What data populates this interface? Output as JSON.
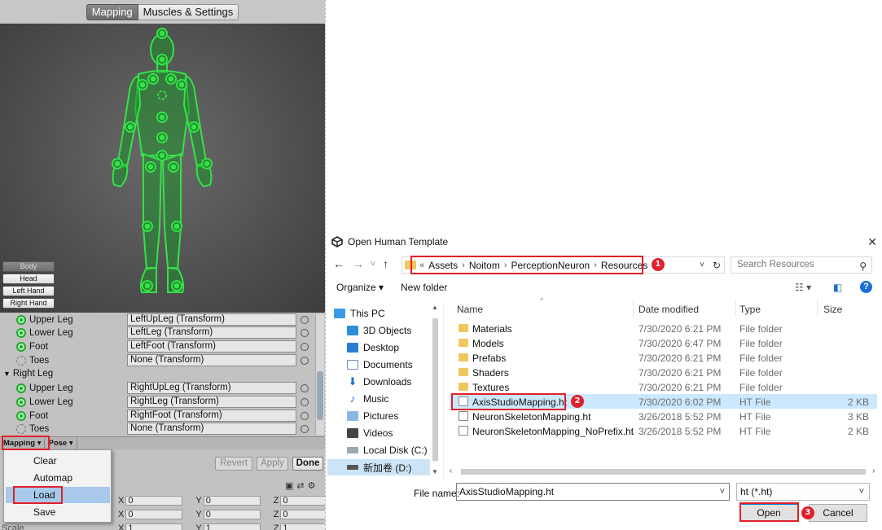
{
  "unity": {
    "tabs": [
      "Mapping",
      "Muscles & Settings"
    ],
    "group_buttons": [
      "Body",
      "Head",
      "Left Hand",
      "Right Hand"
    ],
    "rows": [
      {
        "label": "Upper Leg",
        "value": "LeftUpLeg (Transform)"
      },
      {
        "label": "Lower Leg",
        "value": "LeftLeg (Transform)"
      },
      {
        "label": "Foot",
        "value": "LeftFoot (Transform)"
      },
      {
        "label": "Toes",
        "value": "None (Transform)"
      }
    ],
    "section_right_leg": "Right Leg",
    "rows_right": [
      {
        "label": "Upper Leg",
        "value": "RightUpLeg (Transform)"
      },
      {
        "label": "Lower Leg",
        "value": "RightLeg (Transform)"
      },
      {
        "label": "Foot",
        "value": "RightFoot (Transform)"
      },
      {
        "label": "Toes",
        "value": "None (Transform)"
      }
    ],
    "bar": {
      "mapping": "Mapping",
      "pose": "Pose"
    },
    "actions": {
      "revert": "Revert",
      "apply": "Apply",
      "done": "Done"
    },
    "menu": [
      "Clear",
      "Automap",
      "Load",
      "Save"
    ],
    "transform": {
      "x": "X",
      "y": "Y",
      "z": "Z",
      "r1": [
        "0",
        "0",
        "0"
      ],
      "r2": [
        "0",
        "0",
        "0"
      ],
      "r3": [
        "1",
        "1",
        "1"
      ],
      "scale_label": "Scale"
    },
    "colors": {
      "accent_green": "#1faa2e",
      "menu_selected": "#a8c8ec"
    }
  },
  "dialog": {
    "title": "Open Human Template",
    "breadcrumb": [
      "Assets",
      "Noitom",
      "PerceptionNeuron",
      "Resources"
    ],
    "breadcrumb_prefix": "«",
    "search_placeholder": "Search Resources",
    "organize": "Organize ▾",
    "new_folder": "New folder",
    "sidebar": [
      {
        "label": "This PC",
        "icon": "computer-icon"
      },
      {
        "label": "3D Objects",
        "icon": "cube-icon"
      },
      {
        "label": "Desktop",
        "icon": "desktop-icon"
      },
      {
        "label": "Documents",
        "icon": "documents-icon"
      },
      {
        "label": "Downloads",
        "icon": "download-icon"
      },
      {
        "label": "Music",
        "icon": "music-icon"
      },
      {
        "label": "Pictures",
        "icon": "pictures-icon"
      },
      {
        "label": "Videos",
        "icon": "videos-icon"
      },
      {
        "label": "Local Disk (C:)",
        "icon": "disk-icon"
      },
      {
        "label": "新加卷 (D:)",
        "icon": "drive-icon"
      }
    ],
    "columns": {
      "name": "Name",
      "date": "Date modified",
      "type": "Type",
      "size": "Size"
    },
    "files": [
      {
        "name": "Materials",
        "date": "7/30/2020 6:21 PM",
        "type": "File folder",
        "size": "",
        "kind": "folder"
      },
      {
        "name": "Models",
        "date": "7/30/2020 6:47 PM",
        "type": "File folder",
        "size": "",
        "kind": "folder"
      },
      {
        "name": "Prefabs",
        "date": "7/30/2020 6:21 PM",
        "type": "File folder",
        "size": "",
        "kind": "folder"
      },
      {
        "name": "Shaders",
        "date": "7/30/2020 6:21 PM",
        "type": "File folder",
        "size": "",
        "kind": "folder"
      },
      {
        "name": "Textures",
        "date": "7/30/2020 6:21 PM",
        "type": "File folder",
        "size": "",
        "kind": "folder"
      },
      {
        "name": "AxisStudioMapping.ht",
        "date": "7/30/2020 6:02 PM",
        "type": "HT File",
        "size": "2 KB",
        "kind": "file"
      },
      {
        "name": "NeuronSkeletonMapping.ht",
        "date": "3/26/2018 5:52 PM",
        "type": "HT File",
        "size": "3 KB",
        "kind": "file"
      },
      {
        "name": "NeuronSkeletonMapping_NoPrefix.ht",
        "date": "3/26/2018 5:52 PM",
        "type": "HT File",
        "size": "2 KB",
        "kind": "file"
      }
    ],
    "file_name_label": "File name:",
    "file_name_value": "AxisStudioMapping.ht",
    "file_type_value": "ht (*.ht)",
    "open": "Open",
    "cancel": "Cancel",
    "colors": {
      "selection": "#cce8ff",
      "folder": "#f0c75e",
      "help_blue": "#1a6fd6"
    }
  },
  "annotations": {
    "badge1": "1",
    "badge2": "2",
    "badge3": "3",
    "color": "#e0202a"
  }
}
